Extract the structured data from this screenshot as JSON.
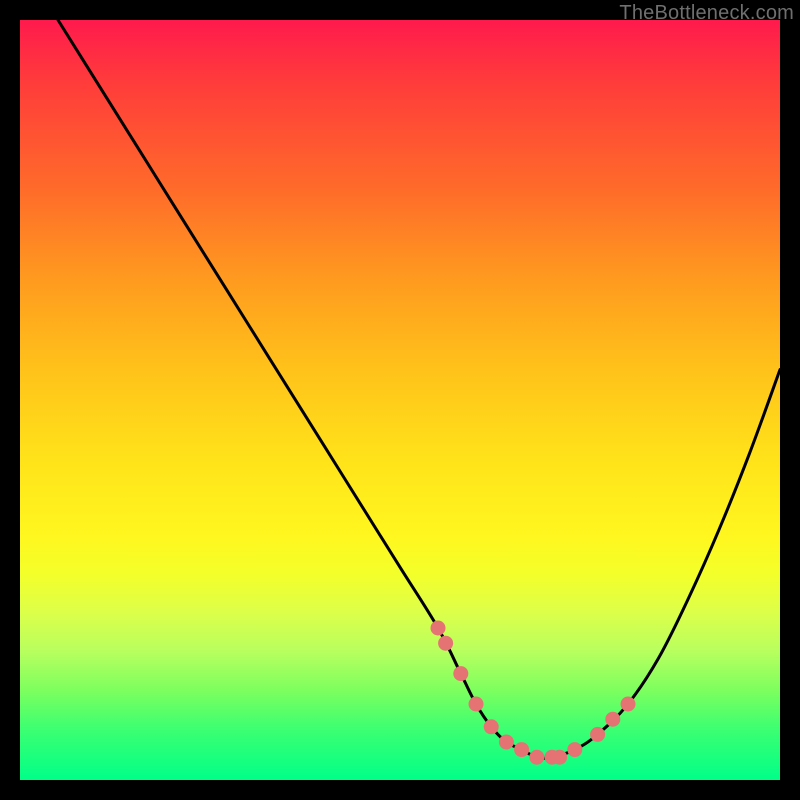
{
  "watermark": "TheBottleneck.com",
  "chart_data": {
    "type": "line",
    "title": "",
    "xlabel": "",
    "ylabel": "",
    "xlim": [
      0,
      100
    ],
    "ylim": [
      0,
      100
    ],
    "grid": false,
    "legend": false,
    "series": [
      {
        "name": "curve",
        "color": "#000000",
        "x": [
          5,
          10,
          15,
          20,
          25,
          30,
          35,
          40,
          45,
          50,
          55,
          58,
          60,
          62,
          64,
          66,
          68,
          70,
          73,
          76,
          80,
          84,
          88,
          92,
          96,
          100
        ],
        "y": [
          100,
          92,
          84,
          76,
          68,
          60,
          52,
          44,
          36,
          28,
          20,
          14,
          10,
          7,
          5,
          4,
          3,
          3,
          4,
          6,
          10,
          16,
          24,
          33,
          43,
          54
        ]
      }
    ],
    "markers": {
      "name": "dots",
      "color": "#e57373",
      "x": [
        55,
        56,
        58,
        60,
        62,
        64,
        66,
        68,
        70,
        71,
        73,
        76,
        78,
        80
      ],
      "y": [
        20,
        18,
        14,
        10,
        7,
        5,
        4,
        3,
        3,
        3,
        4,
        6,
        8,
        10
      ]
    },
    "background_gradient": {
      "top": "#ff1a4d",
      "mid": "#ffe31a",
      "bottom": "#00ff88"
    }
  }
}
